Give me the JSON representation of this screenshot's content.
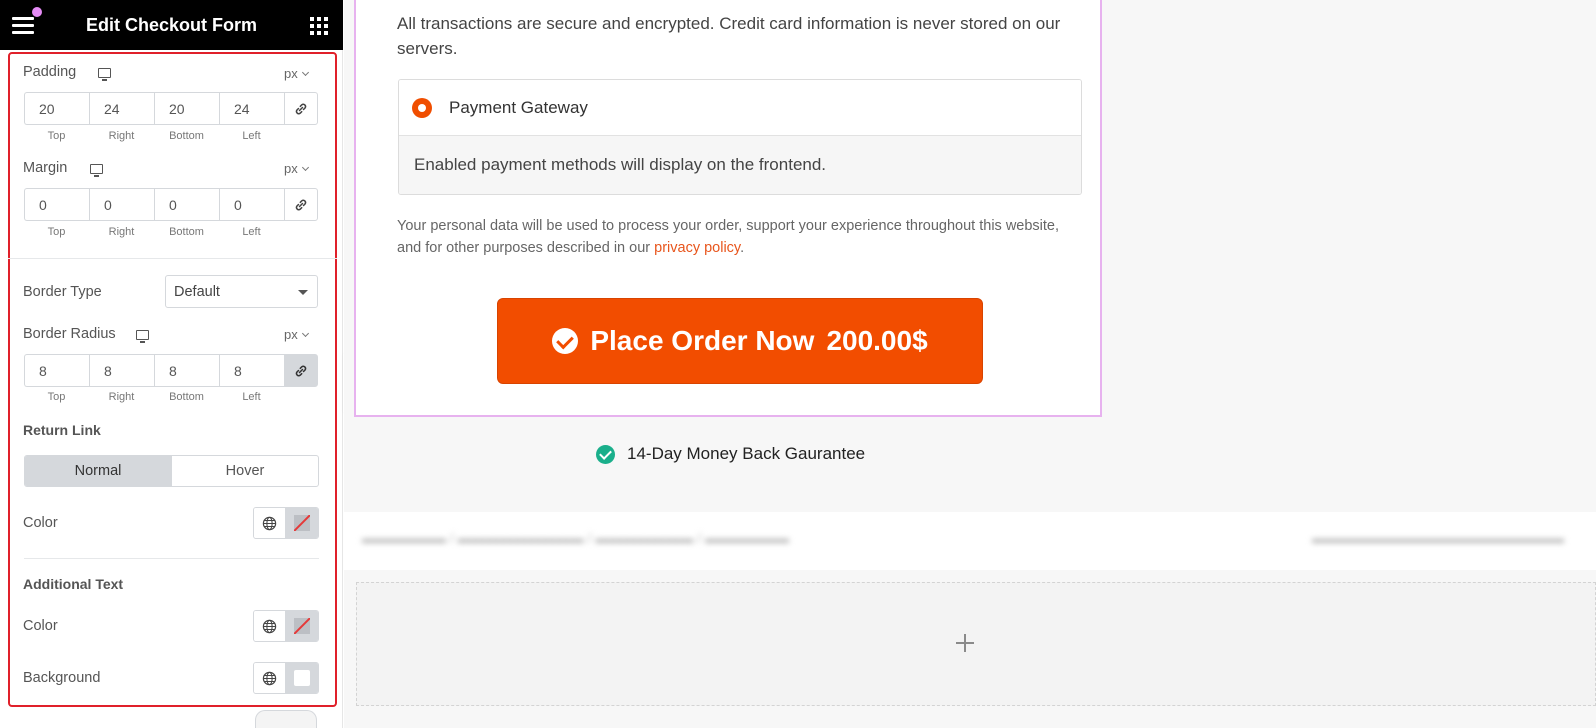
{
  "panel": {
    "title": "Edit Checkout Form",
    "padding": {
      "label": "Padding",
      "unit": "px",
      "values": [
        "20",
        "24",
        "20",
        "24"
      ]
    },
    "margin": {
      "label": "Margin",
      "unit": "px",
      "values": [
        "0",
        "0",
        "0",
        "0"
      ]
    },
    "dimension_labels": [
      "Top",
      "Right",
      "Bottom",
      "Left"
    ],
    "border_type": {
      "label": "Border Type",
      "value": "Default"
    },
    "border_radius": {
      "label": "Border Radius",
      "unit": "px",
      "values": [
        "8",
        "8",
        "8",
        "8"
      ]
    },
    "return_link": {
      "heading": "Return Link",
      "tabs": [
        "Normal",
        "Hover"
      ],
      "color_label": "Color"
    },
    "additional_text": {
      "heading": "Additional Text",
      "color_label": "Color",
      "background_label": "Background"
    }
  },
  "preview": {
    "secure_text": "All transactions are secure and encrypted. Credit card information is never stored on our servers.",
    "gateway_label": "Payment Gateway",
    "gateway_desc": "Enabled payment methods will display on the frontend.",
    "privacy_text": "Your personal data will be used to process your order, support your experience throughout this website, and for other purposes described in our ",
    "privacy_link": "privacy policy",
    "privacy_end": ".",
    "order_button": "Place Order Now",
    "order_price": "200.00$",
    "guarantee": "14-Day Money Back Gaurantee"
  },
  "colors": {
    "accent": "#f24d00",
    "guarantee_check": "#1aaf8b",
    "highlight_border": "#e0202a",
    "widget_outline": "#e7b2ef"
  }
}
